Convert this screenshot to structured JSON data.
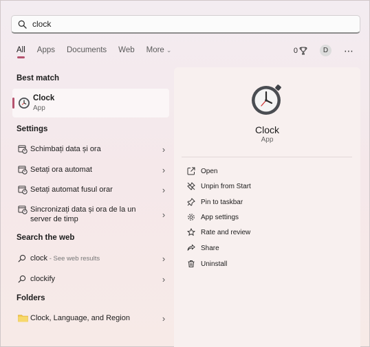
{
  "search": {
    "value": "clock"
  },
  "tabs": [
    {
      "label": "All",
      "active": true
    },
    {
      "label": "Apps"
    },
    {
      "label": "Documents"
    },
    {
      "label": "Web"
    },
    {
      "label": "More"
    }
  ],
  "header_right": {
    "points": "0",
    "avatar_letter": "D"
  },
  "sections": {
    "best_match": "Best match",
    "settings": "Settings",
    "search_web": "Search the web",
    "folders": "Folders"
  },
  "best_match": {
    "name": "Clock",
    "type": "App",
    "icon": "clock-icon"
  },
  "settings_items": [
    {
      "label": "Schimbați data și ora",
      "icon": "calendar-clock-icon"
    },
    {
      "label": "Setați ora automat",
      "icon": "calendar-clock-icon"
    },
    {
      "label": "Setați automat fusul orar",
      "icon": "calendar-clock-icon"
    },
    {
      "label": "Sincronizați data și ora de la un server de timp",
      "icon": "calendar-clock-icon"
    }
  ],
  "web_items": [
    {
      "label": "clock",
      "hint": " - See web results",
      "icon": "search-icon"
    },
    {
      "label": "clockify",
      "hint": "",
      "icon": "search-icon"
    }
  ],
  "folder_items": [
    {
      "label": "Clock, Language, and Region",
      "icon": "folder-icon"
    }
  ],
  "preview": {
    "name": "Clock",
    "type": "App"
  },
  "actions": [
    {
      "label": "Open",
      "icon": "open-icon"
    },
    {
      "label": "Unpin from Start",
      "icon": "unpin-icon"
    },
    {
      "label": "Pin to taskbar",
      "icon": "pin-icon"
    },
    {
      "label": "App settings",
      "icon": "gear-icon"
    },
    {
      "label": "Rate and review",
      "icon": "star-icon"
    },
    {
      "label": "Share",
      "icon": "share-icon"
    },
    {
      "label": "Uninstall",
      "icon": "trash-icon"
    }
  ],
  "colors": {
    "accent": "#b5526e",
    "clock_face": "#4a4d52"
  }
}
